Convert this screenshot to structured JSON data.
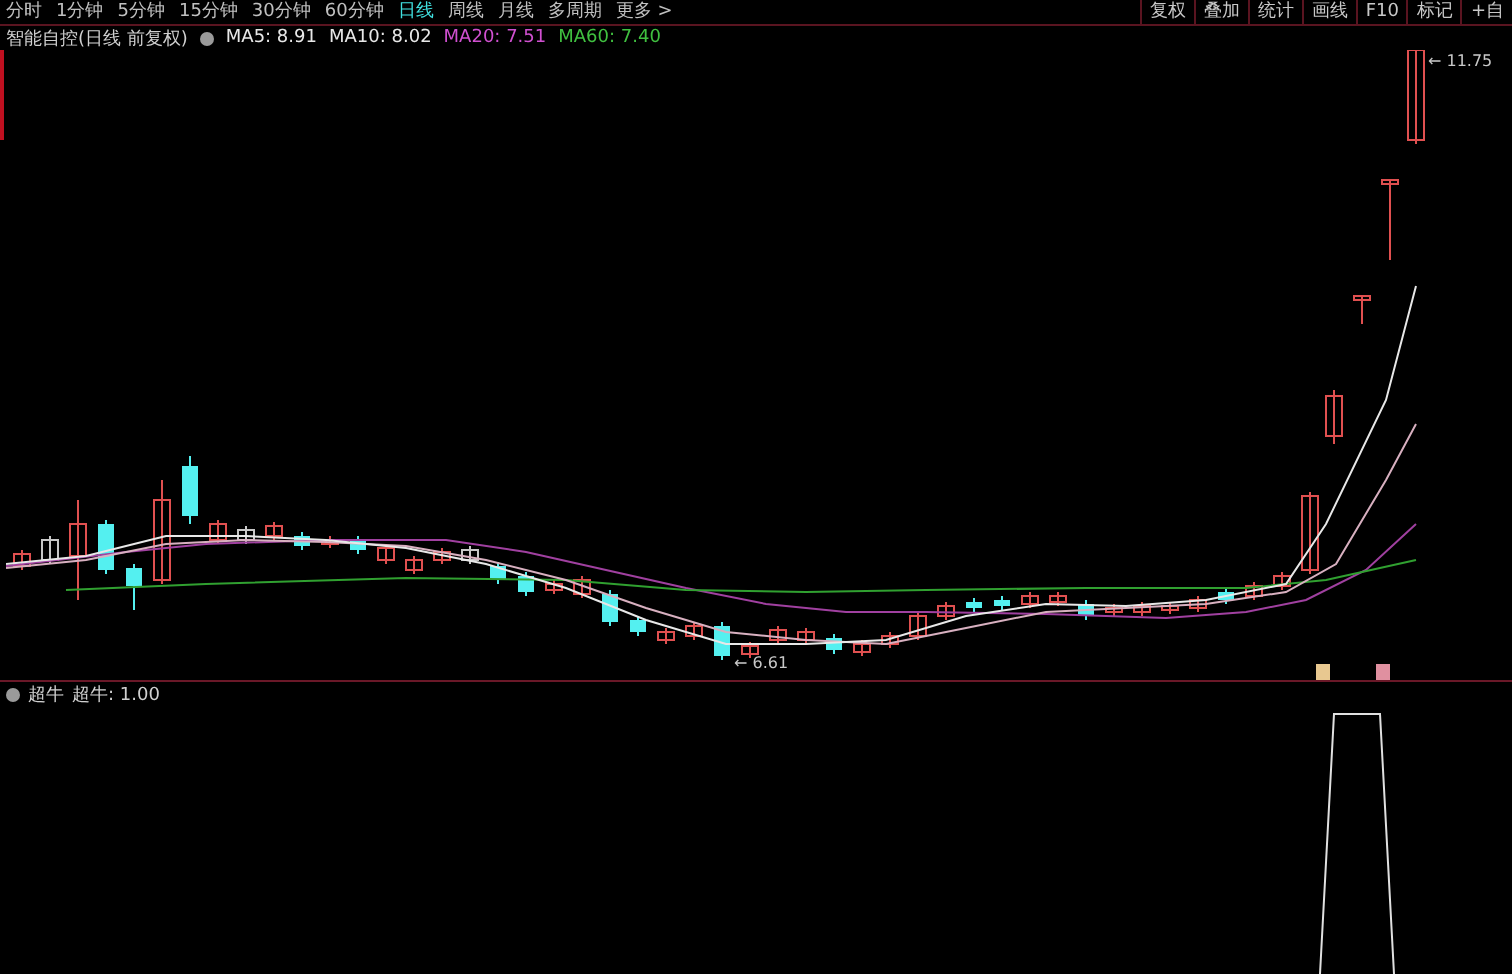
{
  "toolbar": {
    "periods": [
      {
        "label": "分时",
        "selected": false
      },
      {
        "label": "1分钟",
        "selected": false
      },
      {
        "label": "5分钟",
        "selected": false
      },
      {
        "label": "15分钟",
        "selected": false
      },
      {
        "label": "30分钟",
        "selected": false
      },
      {
        "label": "60分钟",
        "selected": false
      },
      {
        "label": "日线",
        "selected": true
      },
      {
        "label": "周线",
        "selected": false
      },
      {
        "label": "月线",
        "selected": false
      },
      {
        "label": "多周期",
        "selected": false
      },
      {
        "label": "更多 >",
        "selected": false
      }
    ],
    "buttons": [
      "复权",
      "叠加",
      "统计",
      "画线",
      "F10",
      "标记",
      "+自"
    ]
  },
  "main_chart": {
    "title": "智能自控(日线 前复权)",
    "indicators": [
      {
        "label": "MA5: 8.91",
        "color": "#e8e8e8"
      },
      {
        "label": "MA10: 8.02",
        "color": "#e8e8e8"
      },
      {
        "label": "MA20: 7.51",
        "color": "#d050d0"
      },
      {
        "label": "MA60: 7.40",
        "color": "#40c040"
      }
    ],
    "high_label": "← 11.75",
    "low_label": "← 6.61"
  },
  "sub_chart": {
    "title": "超牛",
    "reading": "超牛: 1.00"
  }
}
